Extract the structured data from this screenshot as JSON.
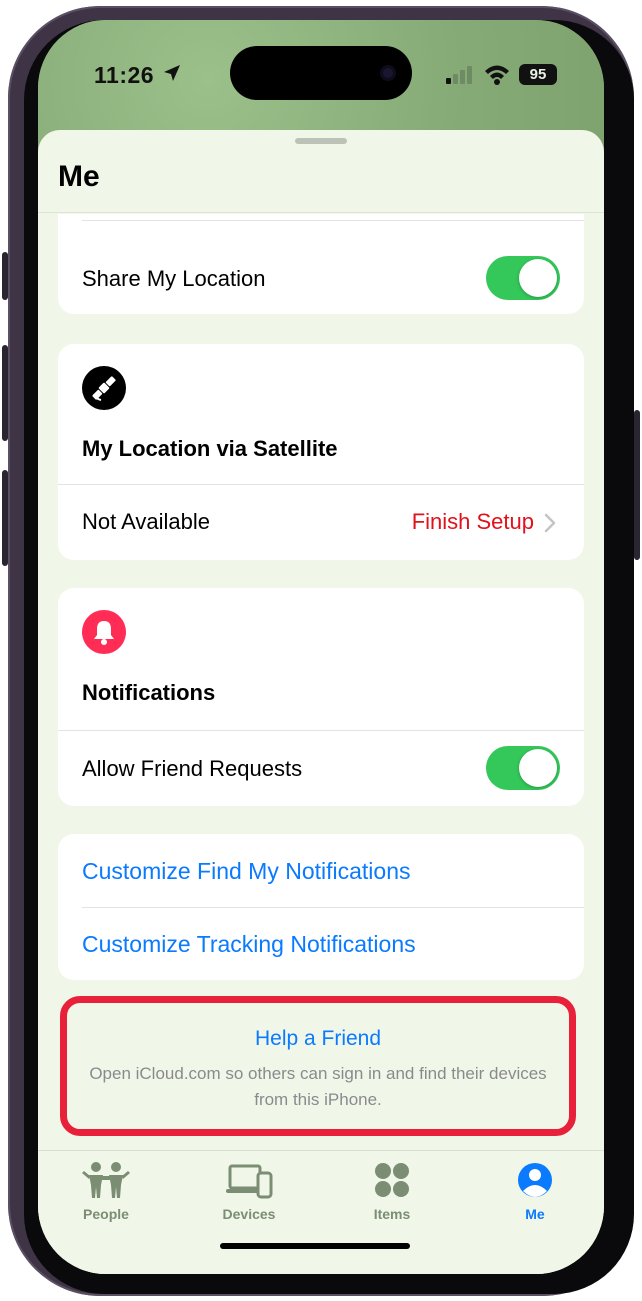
{
  "status": {
    "time": "11:26",
    "battery": "95"
  },
  "sheet": {
    "title": "Me"
  },
  "share_location": {
    "label": "Share My Location",
    "on": true
  },
  "satellite": {
    "icon": "satellite-icon",
    "title": "My Location via Satellite",
    "status_label": "Not Available",
    "action_label": "Finish Setup",
    "action_color": "#e0121b"
  },
  "notifications": {
    "icon": "bell-icon",
    "title": "Notifications",
    "allow_friend_requests_label": "Allow Friend Requests",
    "allow_friend_requests_on": true
  },
  "links": {
    "customize_find_my": "Customize Find My Notifications",
    "customize_tracking": "Customize Tracking Notifications"
  },
  "help_friend": {
    "title": "Help a Friend",
    "description": "Open iCloud.com so others can sign in and find their devices from this iPhone."
  },
  "tabbar": {
    "tabs": [
      {
        "label": "People",
        "icon": "people-icon",
        "selected": false
      },
      {
        "label": "Devices",
        "icon": "devices-icon",
        "selected": false
      },
      {
        "label": "Items",
        "icon": "items-icon",
        "selected": false
      },
      {
        "label": "Me",
        "icon": "person-icon",
        "selected": true
      }
    ]
  },
  "colors": {
    "accent": "#0a7aff",
    "toggle_on": "#34c759",
    "highlight_border": "#e8203a",
    "sheet_background": "#f1f7e8"
  }
}
